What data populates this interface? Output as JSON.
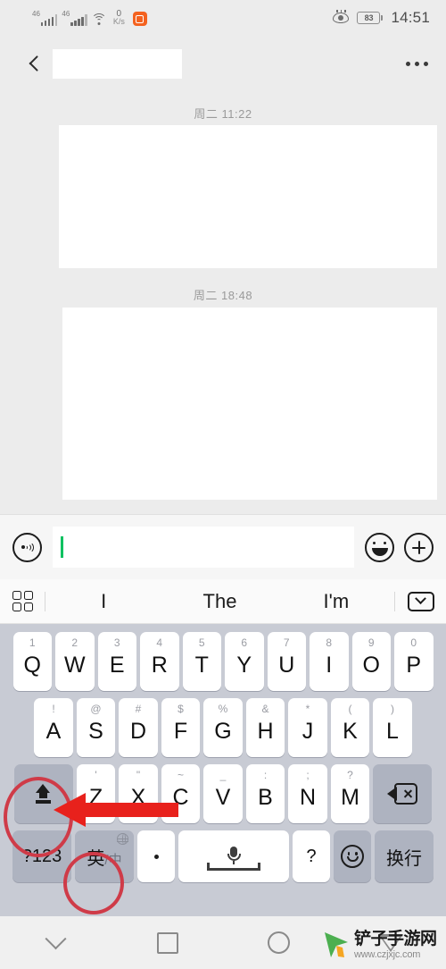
{
  "status_bar": {
    "signal_1_label": "46",
    "signal_2_label": "46",
    "network_speed_value": "0",
    "network_speed_unit": "K/s",
    "battery_percent": "83",
    "time": "14:51"
  },
  "title_bar": {
    "back_icon": "chevron-left-icon",
    "contact_name": "",
    "more_icon": "more-horizontal-icon"
  },
  "chat": {
    "messages": [
      {
        "timestamp": "周二 11:22",
        "body": ""
      },
      {
        "timestamp": "周二 18:48",
        "body": ""
      }
    ]
  },
  "input_bar": {
    "voice_icon": "voice-wave-icon",
    "text_value": "",
    "placeholder": "",
    "emoji_icon": "smiley-face-icon",
    "plus_icon": "plus-circle-icon",
    "caret_color": "#07c160"
  },
  "keyboard": {
    "suggestion_bar": {
      "grid_icon": "grid-menu-icon",
      "suggestions": [
        "I",
        "The",
        "I'm"
      ],
      "hide_icon": "chevron-down-box-icon"
    },
    "row1": [
      {
        "hint": "1",
        "label": "Q"
      },
      {
        "hint": "2",
        "label": "W"
      },
      {
        "hint": "3",
        "label": "E"
      },
      {
        "hint": "4",
        "label": "R"
      },
      {
        "hint": "5",
        "label": "T"
      },
      {
        "hint": "6",
        "label": "Y"
      },
      {
        "hint": "7",
        "label": "U"
      },
      {
        "hint": "8",
        "label": "I"
      },
      {
        "hint": "9",
        "label": "O"
      },
      {
        "hint": "0",
        "label": "P"
      }
    ],
    "row2": [
      {
        "hint": "!",
        "label": "A"
      },
      {
        "hint": "@",
        "label": "S"
      },
      {
        "hint": "#",
        "label": "D"
      },
      {
        "hint": "$",
        "label": "F"
      },
      {
        "hint": "%",
        "label": "G"
      },
      {
        "hint": "&",
        "label": "H"
      },
      {
        "hint": "*",
        "label": "J"
      },
      {
        "hint": "(",
        "label": "K"
      },
      {
        "hint": ")",
        "label": "L"
      }
    ],
    "row3": {
      "shift_icon": "shift-arrow-icon",
      "keys": [
        {
          "hint": "'",
          "label": "Z"
        },
        {
          "hint": "\"",
          "label": "X"
        },
        {
          "hint": "~",
          "label": "C"
        },
        {
          "hint": "_",
          "label": "V"
        },
        {
          "hint": ":",
          "label": "B"
        },
        {
          "hint": ";",
          "label": "N"
        },
        {
          "hint": "?",
          "label": "M"
        }
      ],
      "backspace_icon": "backspace-icon"
    },
    "row4": {
      "symbols_label": "?123",
      "lang_primary": "英",
      "lang_separator": "/",
      "lang_secondary": "中",
      "globe_icon": "globe-icon",
      "period_label": "·",
      "space_mic_icon": "microphone-icon",
      "question_label": "?",
      "emoji_icon": "smiley-key-icon",
      "enter_label": "换行"
    }
  },
  "annotations": {
    "color": "#cf3b48",
    "highlight_shift_key": "shift-key",
    "highlight_language_key": "language-toggle-key",
    "arrow": "red-arrow-pointing-left"
  },
  "nav_bar": {
    "items": [
      "chevron-down-icon",
      "square-icon",
      "circle-icon",
      "triangle-icon"
    ]
  },
  "watermark": {
    "site_name": "铲子手游网",
    "url": "www.czjxjc.com"
  }
}
